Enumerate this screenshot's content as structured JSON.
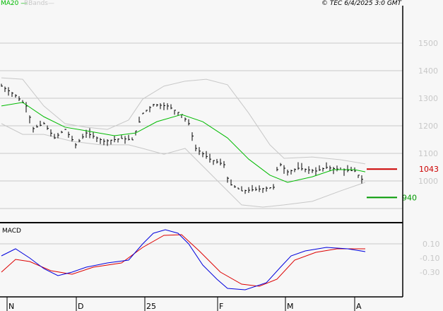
{
  "header": {
    "ma_label": "MA20",
    "bb_label": "BBands",
    "copyright": "© TEC 6/4/2025 3:0 GMT",
    "macd_label": "MACD"
  },
  "chart_data": [
    {
      "type": "line",
      "title": "Price with MA20 and Bollinger Bands",
      "x_unit": "trading day index",
      "yticks": [
        "1500",
        "1400",
        "1300",
        "1200",
        "1100",
        "1000"
      ],
      "ytick_values": [
        1500,
        1400,
        1300,
        1200,
        1100,
        1000
      ],
      "ylim": [
        860,
        1650
      ],
      "xticks": [
        "N",
        "D",
        "25",
        "F",
        "M",
        "A"
      ],
      "xtick_days": [
        2,
        21.6,
        41,
        61.6,
        80.8,
        100.4
      ],
      "levels": [
        {
          "label": "1043",
          "value": 1043,
          "color": "#cc0000"
        },
        {
          "label": "940",
          "value": 940,
          "color": "#009900"
        }
      ],
      "close": [
        [
          0,
          1344
        ],
        [
          4,
          1310
        ],
        [
          7,
          1272
        ],
        [
          9,
          1190
        ],
        [
          12,
          1208
        ],
        [
          15,
          1156
        ],
        [
          18,
          1187
        ],
        [
          21,
          1131
        ],
        [
          24,
          1174
        ],
        [
          29,
          1144
        ],
        [
          34,
          1154
        ],
        [
          37,
          1149
        ],
        [
          40,
          1246
        ],
        [
          43,
          1277
        ],
        [
          47,
          1272
        ],
        [
          51,
          1241
        ],
        [
          53,
          1208
        ],
        [
          55,
          1118
        ],
        [
          59,
          1079
        ],
        [
          63,
          1059
        ],
        [
          64.4,
          990
        ],
        [
          68,
          964
        ],
        [
          72,
          969
        ],
        [
          77,
          977
        ],
        [
          78.4,
          1067
        ],
        [
          81,
          1033
        ],
        [
          84,
          1046
        ],
        [
          89,
          1036
        ],
        [
          92,
          1049
        ],
        [
          96,
          1041
        ],
        [
          100,
          1036
        ],
        [
          102.4,
          1000
        ]
      ],
      "ma20": [
        [
          0,
          1272
        ],
        [
          6,
          1285
        ],
        [
          12,
          1233
        ],
        [
          18,
          1195
        ],
        [
          24,
          1182
        ],
        [
          32,
          1164
        ],
        [
          38,
          1174
        ],
        [
          44,
          1215
        ],
        [
          51,
          1241
        ],
        [
          57,
          1215
        ],
        [
          64,
          1156
        ],
        [
          70,
          1079
        ],
        [
          76,
          1021
        ],
        [
          81,
          995
        ],
        [
          88,
          1015
        ],
        [
          94,
          1041
        ],
        [
          100,
          1041
        ],
        [
          103,
          1033
        ]
      ],
      "bb_upper": [
        [
          0,
          1374
        ],
        [
          6,
          1369
        ],
        [
          12,
          1272
        ],
        [
          18,
          1208
        ],
        [
          24,
          1195
        ],
        [
          30,
          1187
        ],
        [
          36,
          1221
        ],
        [
          40,
          1297
        ],
        [
          46,
          1344
        ],
        [
          52,
          1362
        ],
        [
          58,
          1369
        ],
        [
          64,
          1349
        ],
        [
          70,
          1246
        ],
        [
          76,
          1131
        ],
        [
          80,
          1082
        ],
        [
          88,
          1087
        ],
        [
          96,
          1077
        ],
        [
          103,
          1062
        ]
      ],
      "bb_lower": [
        [
          0,
          1208
        ],
        [
          6,
          1169
        ],
        [
          12,
          1169
        ],
        [
          20,
          1144
        ],
        [
          28,
          1131
        ],
        [
          36,
          1131
        ],
        [
          40,
          1118
        ],
        [
          46,
          1097
        ],
        [
          52,
          1118
        ],
        [
          58,
          1041
        ],
        [
          64,
          964
        ],
        [
          68,
          913
        ],
        [
          74,
          905
        ],
        [
          80,
          913
        ],
        [
          88,
          926
        ],
        [
          96,
          964
        ],
        [
          103,
          995
        ]
      ]
    },
    {
      "type": "line",
      "title": "MACD",
      "yticks": [
        "0.10",
        "-0.10",
        "-0.30"
      ],
      "ytick_values": [
        0.1,
        -0.1,
        -0.3
      ],
      "ylim": [
        -0.75,
        0.4
      ],
      "macd": [
        [
          0,
          -0.07
        ],
        [
          4,
          0.03
        ],
        [
          8,
          -0.1
        ],
        [
          12,
          -0.25
        ],
        [
          16,
          -0.35
        ],
        [
          20,
          -0.3
        ],
        [
          24,
          -0.23
        ],
        [
          30,
          -0.17
        ],
        [
          36,
          -0.13
        ],
        [
          40,
          0.1
        ],
        [
          43,
          0.25
        ],
        [
          46.4,
          0.3
        ],
        [
          50,
          0.25
        ],
        [
          53,
          0.1
        ],
        [
          57,
          -0.2
        ],
        [
          61,
          -0.4
        ],
        [
          64,
          -0.53
        ],
        [
          69,
          -0.55
        ],
        [
          75,
          -0.45
        ],
        [
          79,
          -0.23
        ],
        [
          82,
          -0.07
        ],
        [
          86,
          0
        ],
        [
          92,
          0.05
        ],
        [
          98,
          0.03
        ],
        [
          103,
          -0.01
        ]
      ],
      "signal": [
        [
          0,
          -0.3
        ],
        [
          4,
          -0.12
        ],
        [
          8,
          -0.15
        ],
        [
          14,
          -0.28
        ],
        [
          20,
          -0.33
        ],
        [
          26,
          -0.23
        ],
        [
          34,
          -0.17
        ],
        [
          40,
          0.05
        ],
        [
          46,
          0.22
        ],
        [
          51,
          0.23
        ],
        [
          56,
          0
        ],
        [
          62,
          -0.3
        ],
        [
          68,
          -0.47
        ],
        [
          73,
          -0.5
        ],
        [
          78,
          -0.4
        ],
        [
          83,
          -0.13
        ],
        [
          89,
          -0.02
        ],
        [
          95,
          0.03
        ],
        [
          103,
          0.03
        ]
      ]
    }
  ],
  "colors": {
    "ma": "#00bb00",
    "bb": "#c8c8c8",
    "macd": "#0000dd",
    "signal": "#dd0000",
    "bars": "#000000"
  }
}
